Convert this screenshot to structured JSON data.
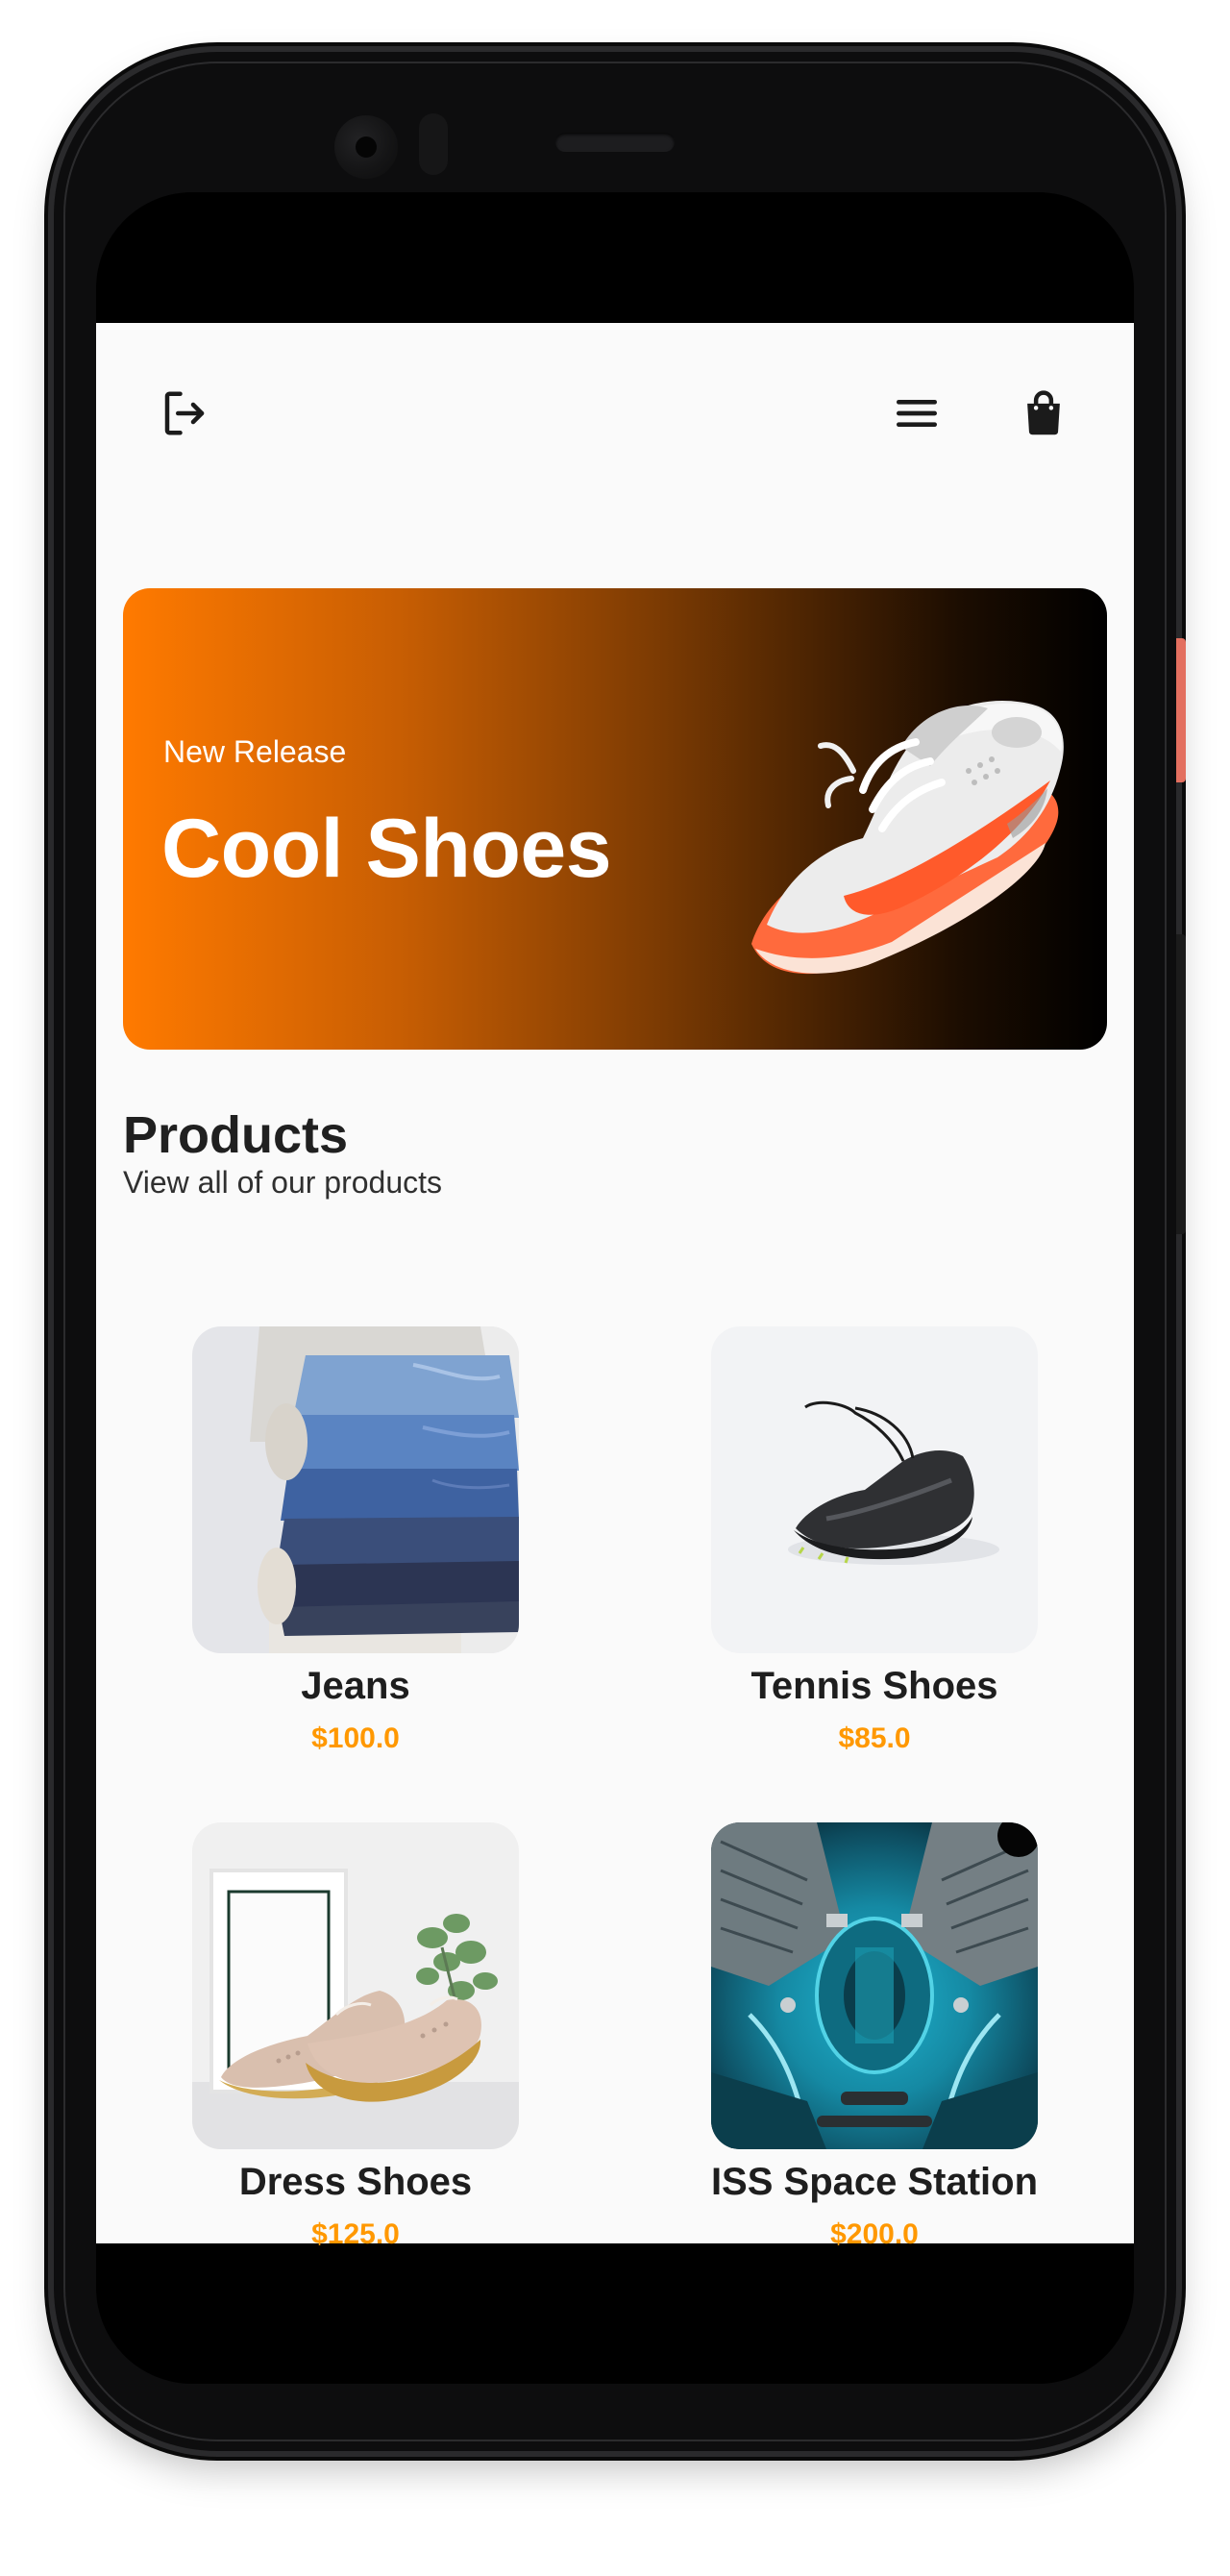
{
  "header": {
    "logout_icon": "logout-icon",
    "menu_icon": "menu-icon",
    "cart_icon": "shopping-bag-icon"
  },
  "banner": {
    "subtitle": "New Release",
    "title": "Cool Shoes",
    "image": "orange-white-sneaker"
  },
  "products_section": {
    "title": "Products",
    "subtitle": "View all of our products",
    "items": [
      {
        "name": "Jeans",
        "price": "$100.0",
        "image": "stacked-jeans"
      },
      {
        "name": "Tennis Shoes",
        "price": "$85.0",
        "image": "black-tennis-shoe"
      },
      {
        "name": "Dress Shoes",
        "price": "$125.0",
        "image": "beige-dress-shoes"
      },
      {
        "name": "ISS Space Station",
        "price": "$200.0",
        "image": "space-station-interior"
      }
    ]
  },
  "colors": {
    "accent": "#ff9800",
    "banner_start": "#ff7a00",
    "banner_end": "#000000",
    "background": "#fafafa",
    "text": "#1e1e1e"
  }
}
